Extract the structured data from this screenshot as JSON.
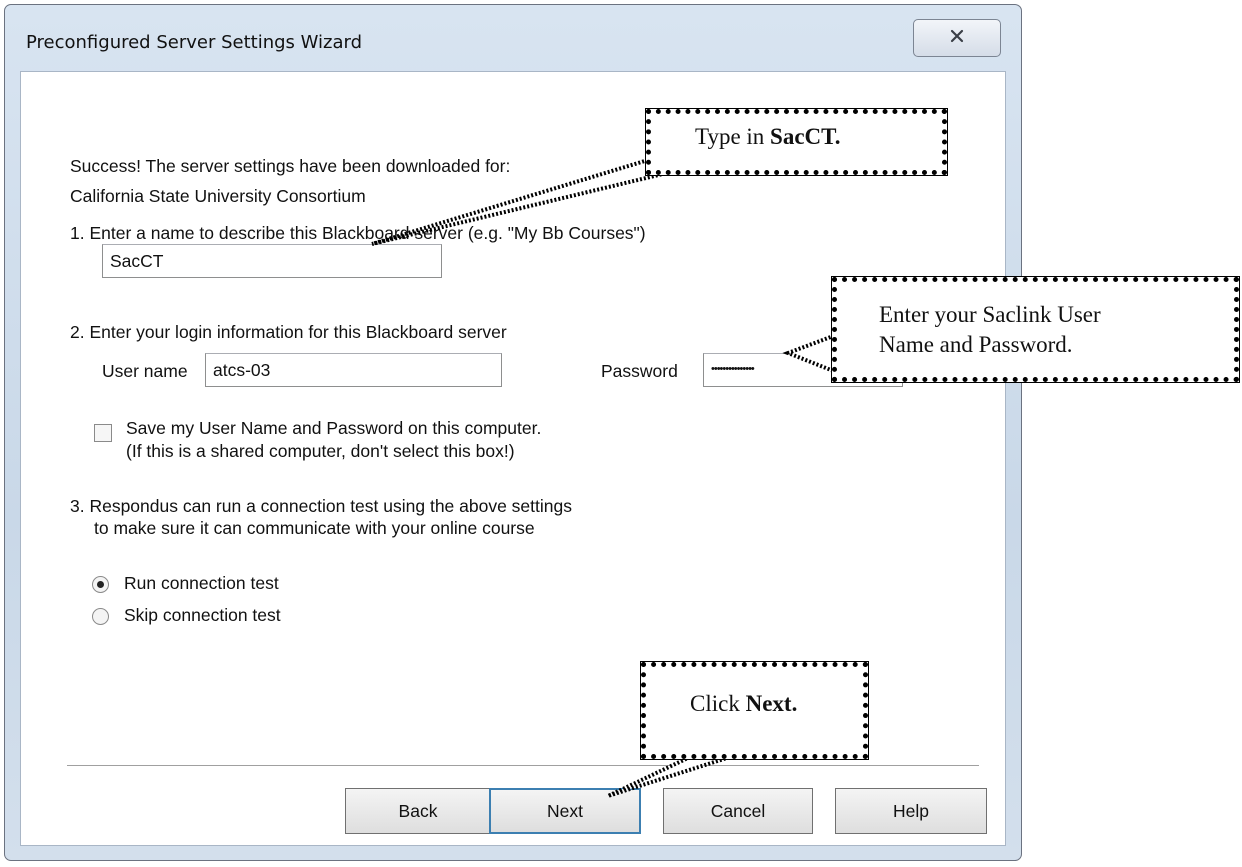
{
  "window": {
    "title": "Preconfigured Server Settings Wizard",
    "close_icon": "close-icon"
  },
  "intro": {
    "line1": "Success! The server settings have been downloaded for:",
    "line2": "California State University Consortium"
  },
  "step1": {
    "label": "1.  Enter a name to describe this Blackboard server (e.g. \"My Bb Courses\")",
    "name_value": "SacCT"
  },
  "step2": {
    "label": "2.  Enter your login information for this Blackboard server",
    "username_label": "User name",
    "username_value": "atcs-03",
    "password_label": "Password",
    "password_value": "•••••••••••••••",
    "save_checkbox_line1": "Save my User Name and Password on this computer.",
    "save_checkbox_line2": "(If this is a shared computer, don't select this box!)",
    "save_checked": false
  },
  "step3": {
    "label_line1": "3.  Respondus can run a connection test using the above settings",
    "label_line2": "to make sure it can communicate with your online course",
    "options": [
      "Run connection test",
      "Skip connection test"
    ],
    "selected": "Run connection test"
  },
  "buttons": {
    "back": "Back",
    "next": "Next",
    "cancel": "Cancel",
    "help": "Help"
  },
  "callouts": {
    "type_in_prefix": "Type in ",
    "type_in_bold": "SacCT.",
    "enter_line1": "Enter your Saclink User",
    "enter_line2": "Name and Password.",
    "click_prefix": "Click ",
    "click_bold": "Next."
  },
  "colors": {
    "window_frame": "#c9d8e8",
    "client_bg": "#ffffff",
    "callout_border": "#000000"
  }
}
